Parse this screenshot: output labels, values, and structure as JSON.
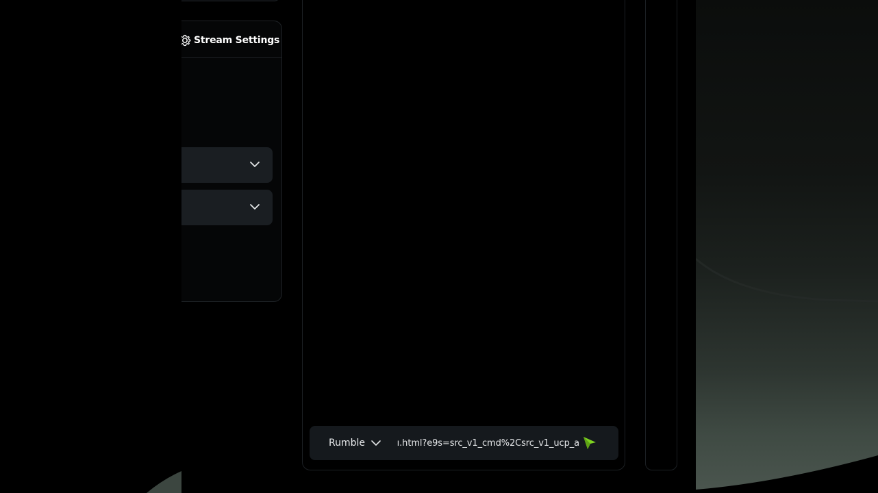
{
  "stream_settings": {
    "title": "Stream Settings",
    "icon": "gear-icon"
  },
  "selects": [
    {
      "name": "stream-setting-select-1",
      "value": ""
    },
    {
      "name": "stream-setting-select-2",
      "value": ""
    }
  ],
  "address_bar": {
    "engine": "Rumble",
    "url": "ı.html?e9s=src_v1_cmd%2Csrc_v1_ucp_a",
    "send_icon": "send-arrow-icon"
  },
  "colors": {
    "accent": "#7ed321",
    "panel_bg": "#050607",
    "field_bg": "#1a1e22",
    "border": "#1f2327"
  }
}
